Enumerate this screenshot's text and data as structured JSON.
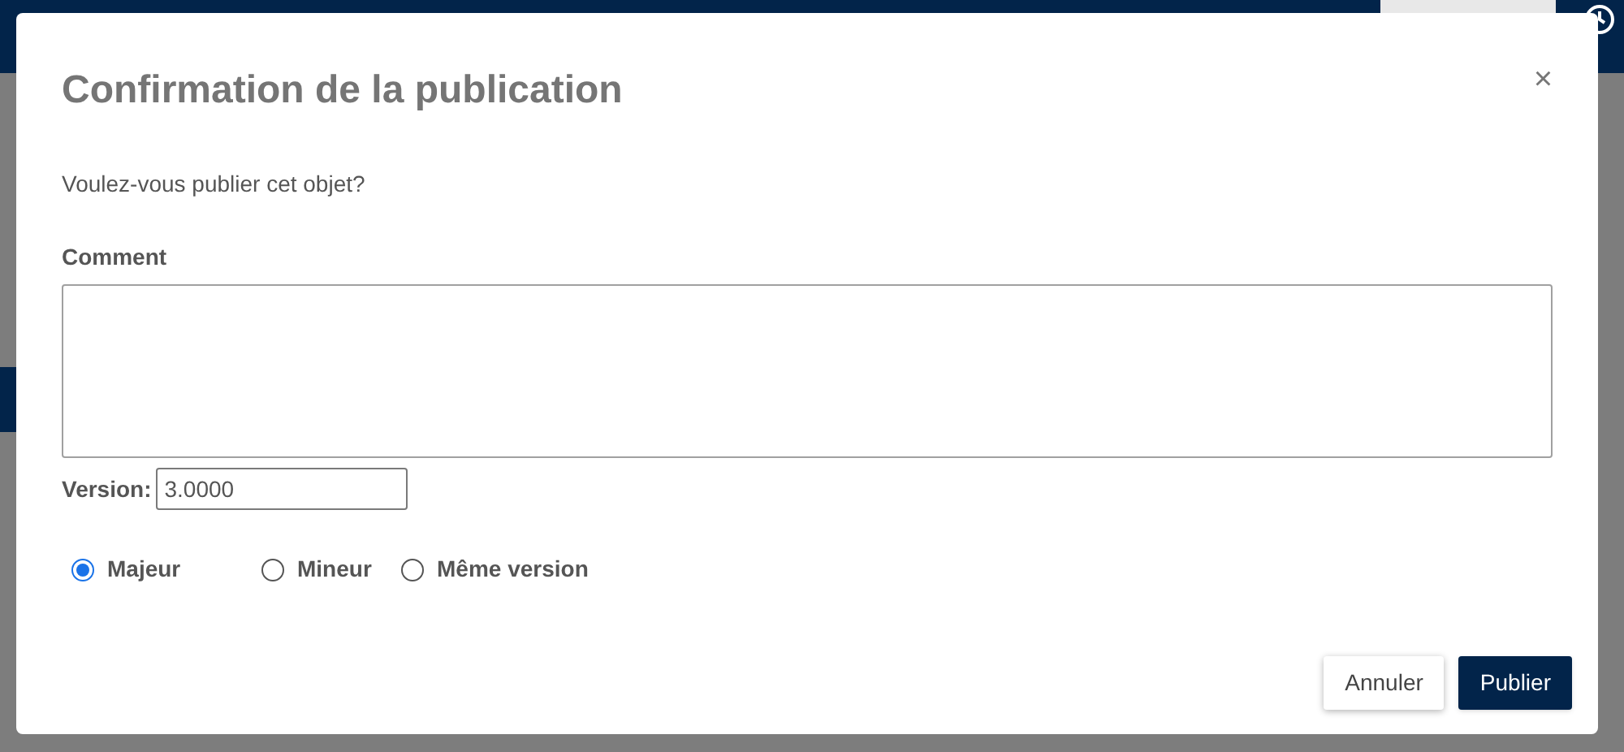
{
  "dialog": {
    "title": "Confirmation de la publication",
    "close": "×",
    "message": "Voulez-vous publier cet objet?",
    "comment": {
      "label": "Comment"
    },
    "version": {
      "label": "Version:",
      "value": "3.0000"
    },
    "options": [
      {
        "label": "Majeur",
        "selected": true
      },
      {
        "label": "Mineur",
        "selected": false
      },
      {
        "label": "Même version",
        "selected": false
      }
    ],
    "buttons": [
      {
        "label": "Annuler",
        "kind": "secondary"
      },
      {
        "label": "Publier",
        "kind": "primary"
      }
    ]
  }
}
